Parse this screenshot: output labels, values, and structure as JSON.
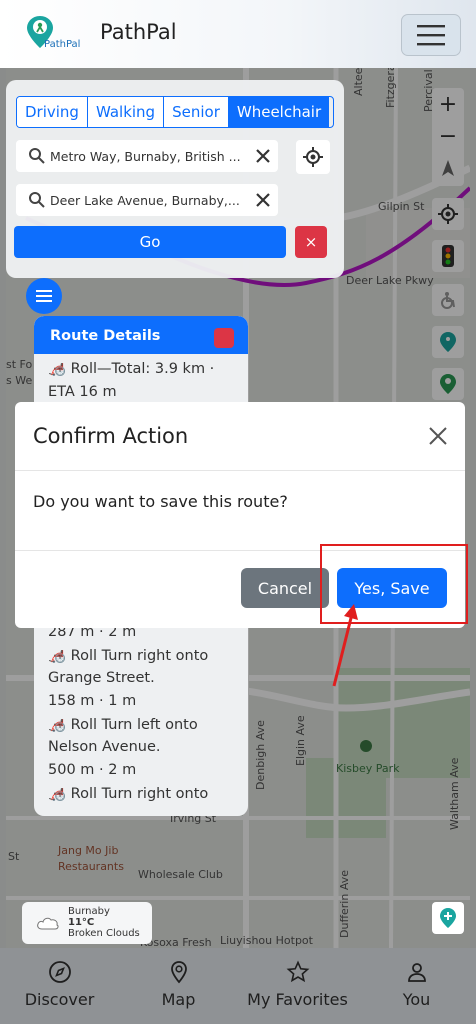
{
  "header": {
    "app_name": "PathPal",
    "logo_text": "PathPal"
  },
  "route_panel": {
    "modes": [
      "Driving",
      "Walking",
      "Senior",
      "Wheelchair"
    ],
    "active_mode": "Wheelchair",
    "origin_value": "Metro Way, Burnaby, British ...",
    "destination_value": "Deer Lake Avenue, Burnaby,...",
    "go_label": "Go",
    "cancel_label": "×"
  },
  "route_details": {
    "title": "Route Details",
    "lines": [
      "🦽 Roll—Total: 3.9 km ·",
      "ETA 16 m",
      "287 m · 2 m",
      "🦽 Roll Turn right onto",
      "Grange Street.",
      "158 m · 1 m",
      "🦽 Roll Turn left onto",
      "Nelson Avenue.",
      "500 m · 2 m",
      "🦽 Roll Turn right onto"
    ]
  },
  "map": {
    "labels": {
      "gilpin": "Gilpin St",
      "deer_lake": "Deer Lake Pkwy",
      "kisbey": "Kisbey Park",
      "jang": "Jang Mo Jib",
      "restaurants": "Restaurants",
      "wholesale": "Wholesale Club",
      "liuyishou": "Liuyishou Hotpot",
      "kosoxa": "Kosoxa Fresh",
      "irving": "Irving St",
      "st_fo": "st Fo",
      "s_we": "s We",
      "st_left": "St",
      "elgin": "Elgin Ave",
      "denbigh": "Denbigh Ave",
      "dufferin": "Dufferin Ave",
      "waltham": "Waltham Ave",
      "fitzgerald": "Fitzgerald",
      "percival": "Percival",
      "altee": "Altee"
    }
  },
  "weather": {
    "city": "Burnaby",
    "temp": "11°C",
    "condition": "Broken Clouds"
  },
  "modal": {
    "title": "Confirm Action",
    "body": "Do you want to save this route?",
    "cancel_label": "Cancel",
    "confirm_label": "Yes, Save"
  },
  "bottom_nav": [
    {
      "label": "Discover",
      "icon": "compass-icon"
    },
    {
      "label": "Map",
      "icon": "map-pin-icon"
    },
    {
      "label": "My Favorites",
      "icon": "star-icon"
    },
    {
      "label": "You",
      "icon": "user-icon"
    }
  ],
  "colors": {
    "primary": "#0d6efd",
    "danger": "#dc3545",
    "secondary": "#6c757d",
    "route": "#b517c8",
    "annotation": "#e01e1e"
  }
}
